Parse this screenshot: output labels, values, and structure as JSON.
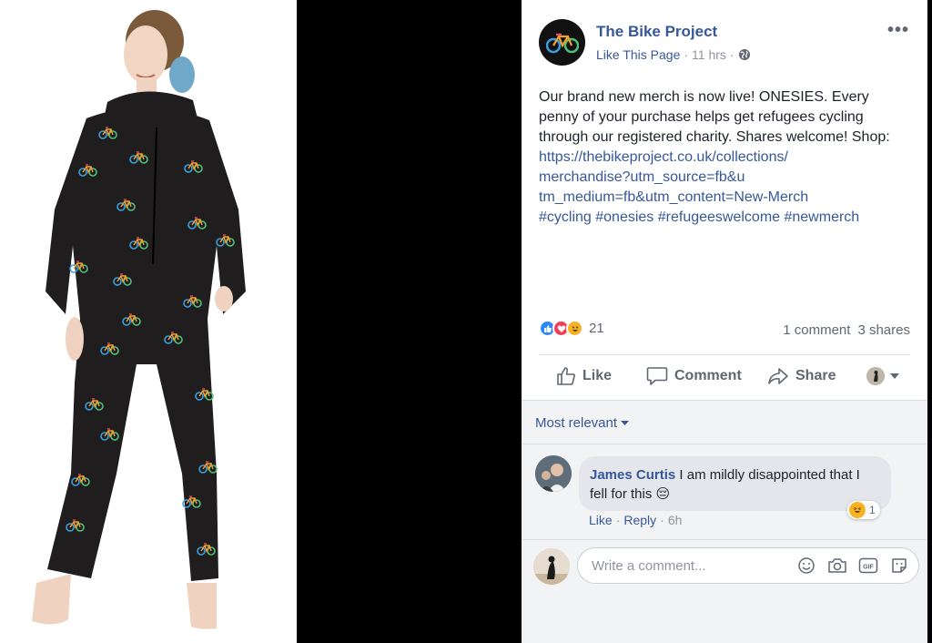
{
  "post": {
    "page_name": "The Bike Project",
    "like_page": "Like This Page",
    "time": "11 hrs",
    "more": "•••",
    "body_text": "Our brand new merch is now live! ONESIES. Every penny of your purchase helps get refugees cycling through our registered charity. Shares welcome!",
    "shop_label": "Shop:",
    "link_line1": "https://thebikeproject.co.uk/collections/",
    "link_line2": "merchandise?utm_source=fb&u",
    "link_line3": "tm_medium=fb&utm_content=New-Merch",
    "hashtags": "#cycling #onesies #refugeeswelcome #newmerch"
  },
  "stats": {
    "reaction_count": "21",
    "comments": "1 comment",
    "shares": "3 shares"
  },
  "actions": {
    "like": "Like",
    "comment": "Comment",
    "share": "Share"
  },
  "comments": {
    "sort": "Most relevant",
    "items": [
      {
        "author": "James Curtis",
        "text": "I am mildly disappointed that I fell for this",
        "emoji": "😔",
        "reaction_count": "1",
        "like": "Like",
        "reply": "Reply",
        "time": "6h"
      }
    ],
    "write_placeholder": "Write a comment..."
  },
  "icons": {
    "page_avatar": "bicycle-logo-icon",
    "globe": "globe-icon",
    "like": "thumbs-up-icon",
    "comment": "speech-bubble-icon",
    "share": "share-arrow-icon",
    "emoji": "smiley-icon",
    "camera": "camera-icon",
    "gif": "gif-icon",
    "sticker": "sticker-icon"
  },
  "colors": {
    "link": "#365899",
    "secondary_text": "#90949c",
    "onesie": "#1f1d1d"
  }
}
